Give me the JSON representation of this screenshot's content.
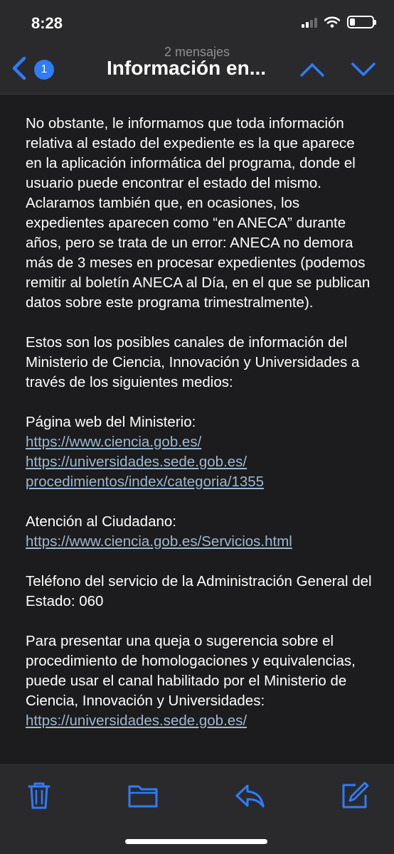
{
  "status": {
    "time": "8:28"
  },
  "header": {
    "subtitle": "2 mensajes",
    "title": "Información en...",
    "badge_count": "1"
  },
  "colors": {
    "accent": "#2f7cf6",
    "link": "#9fb8cf",
    "background": "#1c1c1e"
  },
  "body": {
    "para1": "No obstante, le informamos que toda información relativa al estado del expediente es la que aparece en la aplicación informática del programa, donde el usuario puede encontrar el estado del mismo. Aclaramos también que, en ocasiones, los expedientes aparecen como “en ANECA” durante años, pero se trata de un error: ANECA no demora más de 3 meses en procesar expedientes (podemos remitir al boletín ANECA al Día, en el que se publican datos sobre este programa trimestralmente).",
    "para2": "Estos son los posibles canales de información del Ministerio de Ciencia, Innovación y Universidades a través de los siguientes medios:",
    "web_label": "Página web del Ministerio:",
    "link1": "https://www.ciencia.gob.es/",
    "link2a": "https://universidades.sede.gob.es/",
    "link2b": "procedimientos/index/categoria/1355",
    "atencion_label": "Atención al Ciudadano:",
    "link3": "https://www.ciencia.gob.es/Servicios.html",
    "telefono": "Teléfono del servicio de la Administración General del Estado: 060",
    "queja": "Para presentar una queja o sugerencia sobre el procedimiento de homologaciones y equivalencias, puede usar el canal habilitado por el Ministerio de Ciencia, Innovación y Universidades:",
    "link4": "https://universidades.sede.gob.es/"
  },
  "toolbar": {
    "icons": [
      "trash-icon",
      "folder-icon",
      "reply-icon",
      "compose-icon"
    ]
  }
}
